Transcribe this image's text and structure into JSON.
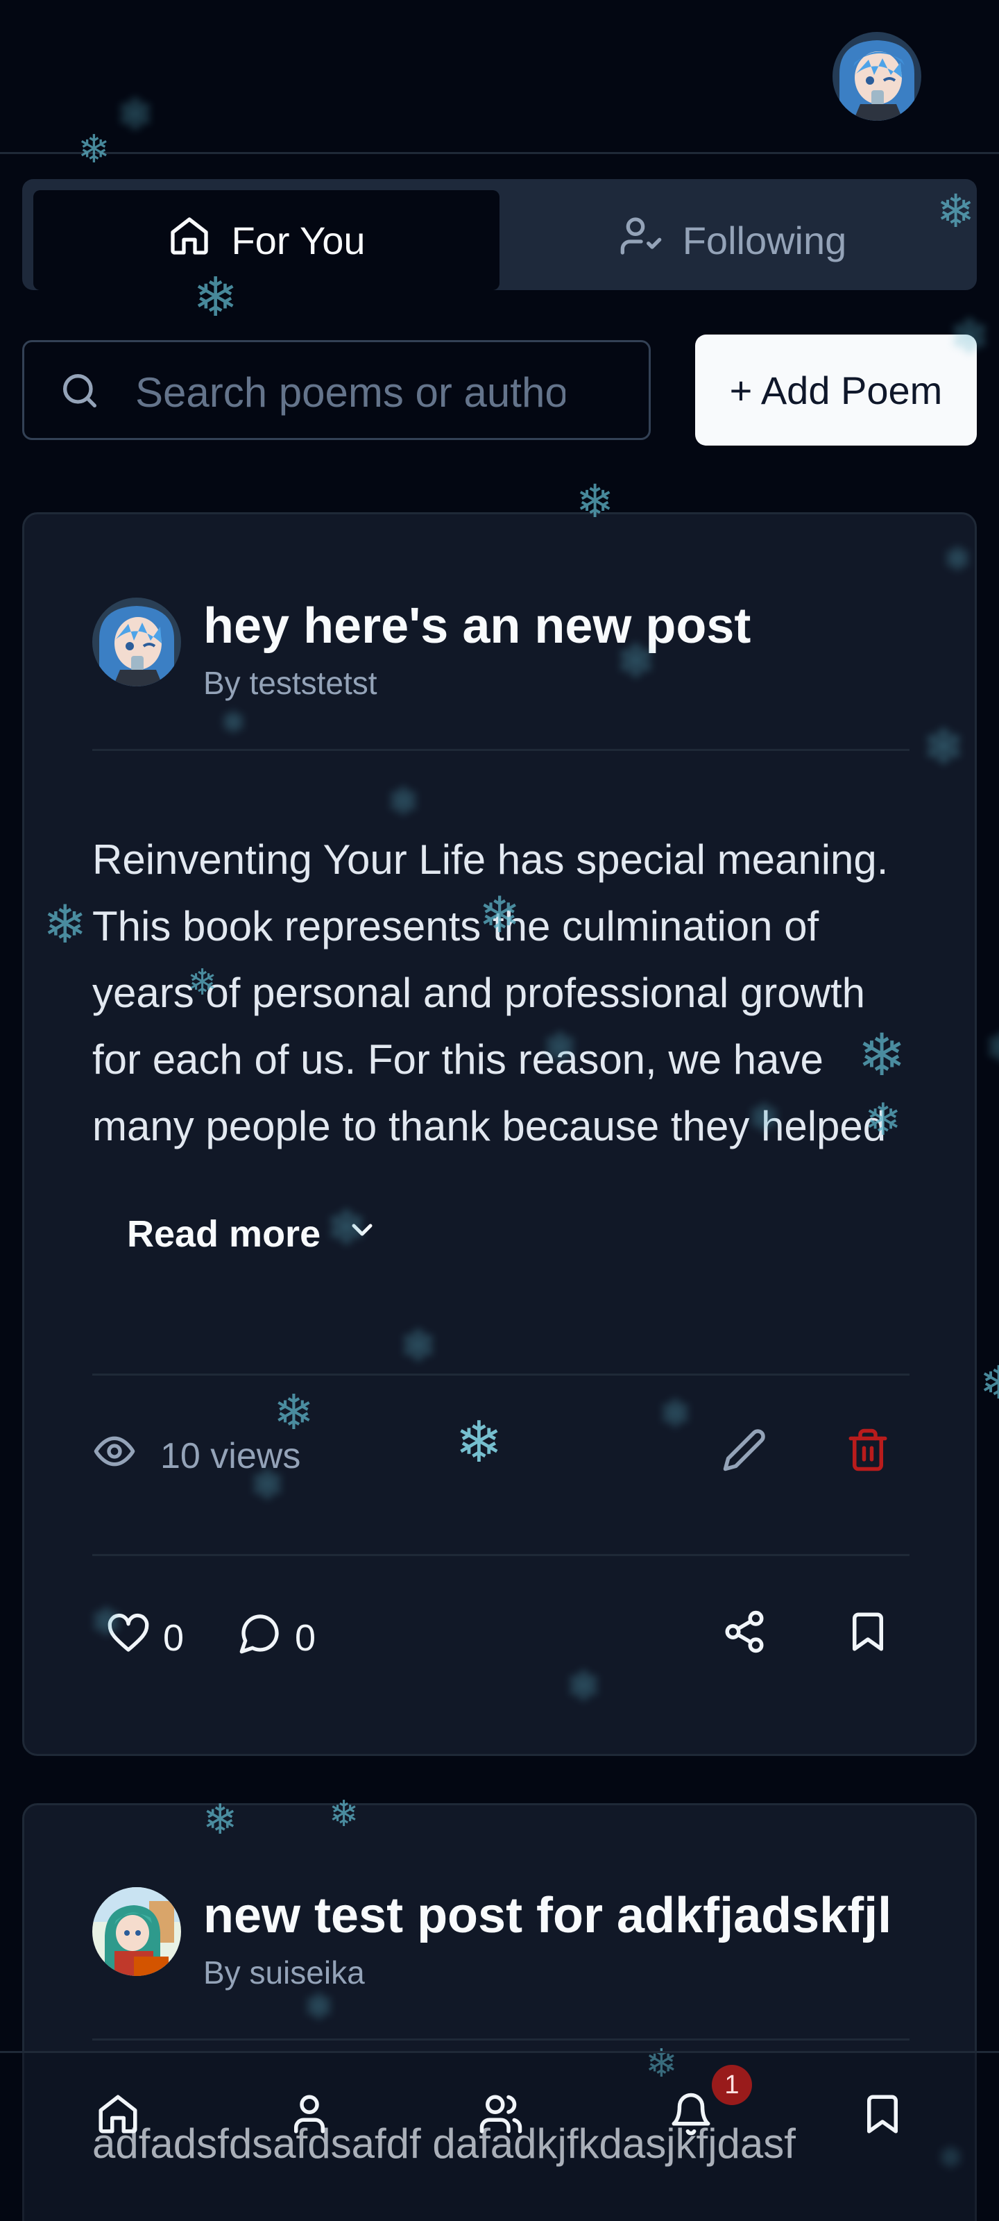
{
  "tabs": [
    {
      "label": "For You",
      "icon": "home-icon",
      "active": true
    },
    {
      "label": "Following",
      "icon": "user-check-icon",
      "active": false
    }
  ],
  "search": {
    "placeholder": "Search poems or authors"
  },
  "add_button": {
    "label": "+ Add Poem"
  },
  "posts": [
    {
      "title": "hey here's an new post",
      "author": "By teststetst",
      "body": "Reinventing Your Life has special meaning. This book represents the culmination of years of personal and professional growth for each of us. For this reason, we have many people to thank because they helped us become who we are.",
      "read_more": "Read more",
      "views": "10 views",
      "likes": "0",
      "comments": "0"
    },
    {
      "title": "new test post for adkfjadskfjl",
      "author": "By suiseika",
      "body": "adfadsfdsafdsafdf dafadkjfkdasjkfjdasf"
    }
  ],
  "nav": {
    "notification_count": "1"
  },
  "colors": {
    "background": "#030712",
    "card": "#111827",
    "danger": "#b91c1c",
    "snow": "#5eb3c8"
  }
}
